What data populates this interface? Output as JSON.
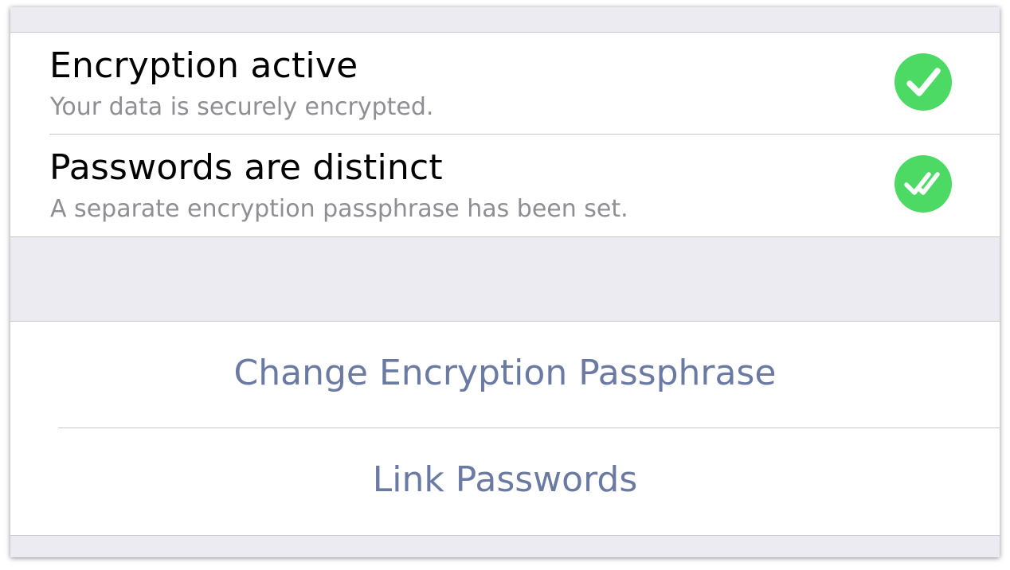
{
  "status": {
    "items": [
      {
        "title": "Encryption active",
        "subtitle": "Your data is securely encrypted.",
        "icon": "check-circle-icon"
      },
      {
        "title": "Passwords are distinct",
        "subtitle": "A separate encryption passphrase has been set.",
        "icon": "double-check-circle-icon"
      }
    ]
  },
  "actions": {
    "items": [
      {
        "label": "Change Encryption Passphrase"
      },
      {
        "label": "Link Passwords"
      }
    ]
  },
  "colors": {
    "background": "#ebebf1",
    "check_green": "#4cd964",
    "action_text": "#6a7aa3",
    "subtitle_gray": "#8e8e93",
    "separator": "#c8c7cc"
  }
}
